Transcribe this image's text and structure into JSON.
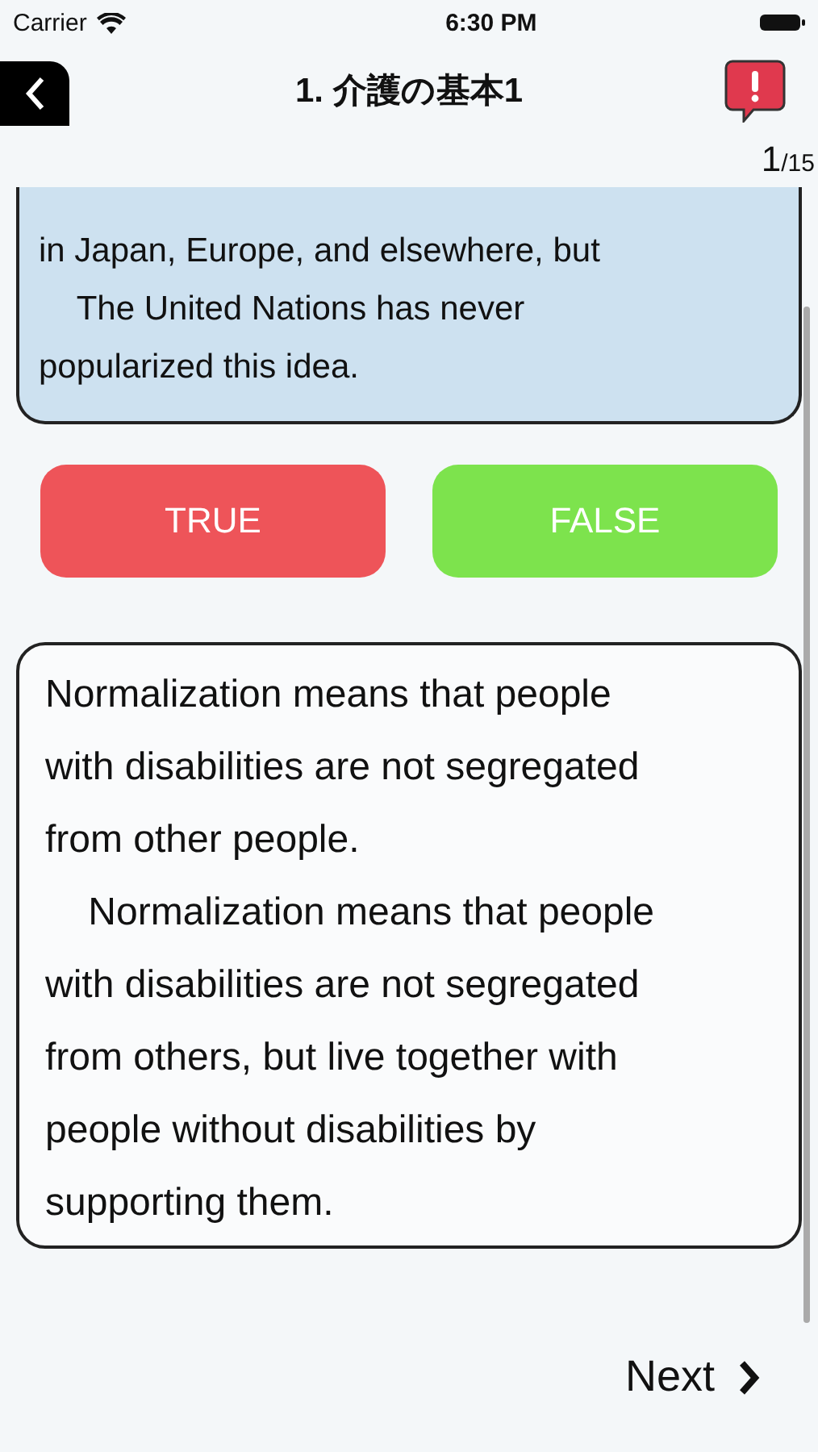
{
  "status_bar": {
    "carrier": "Carrier",
    "time": "6:30 PM"
  },
  "header": {
    "title": "1. 介護の基本1"
  },
  "counter": {
    "current": "1",
    "total": "/15"
  },
  "question": {
    "text": "in Japan, Europe, and elsewhere, but\n    The United Nations has never popularized this idea."
  },
  "answers": [
    {
      "label": "TRUE",
      "kind": "true"
    },
    {
      "label": "FALSE",
      "kind": "false"
    }
  ],
  "explanation": {
    "text": "Normalization means that people with disabilities are not segregated from other people.\n    Normalization means that people with disabilities are not segregated from others, but live together with people without disabilities by supporting them."
  },
  "next_button": {
    "label": "Next"
  }
}
